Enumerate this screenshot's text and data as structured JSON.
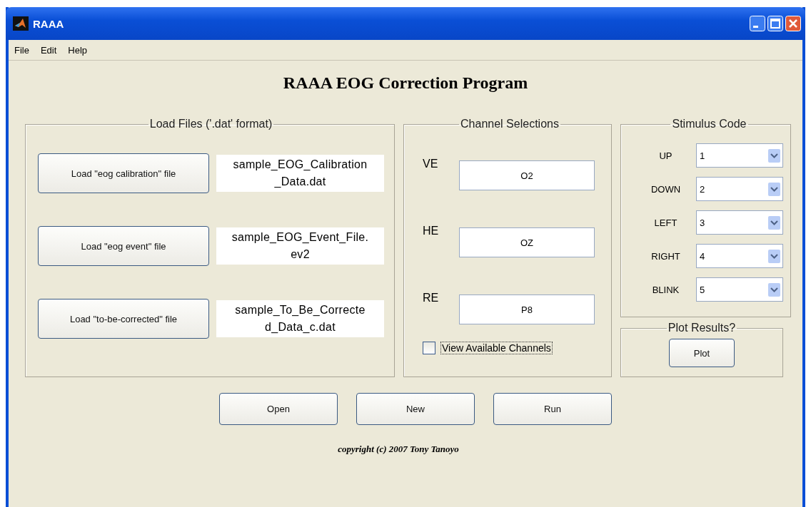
{
  "window": {
    "title": "RAAA"
  },
  "menu": [
    "File",
    "Edit",
    "Help"
  ],
  "heading": "RAAA EOG Correction Program",
  "load_files": {
    "title": "Load Files ('.dat' format)",
    "rows": [
      {
        "button": "Load \"eog calibration\" file",
        "file_lines": [
          "sample_EOG_Calibration",
          "_Data.dat"
        ]
      },
      {
        "button": "Load \"eog event\" file",
        "file_lines": [
          "sample_EOG_Event_File.",
          "ev2"
        ]
      },
      {
        "button": "Load \"to-be-corrected\" file",
        "file_lines": [
          "sample_To_Be_Correcte",
          "d_Data_c.dat"
        ]
      }
    ]
  },
  "channel_selections": {
    "title": "Channel Selections",
    "channels": [
      {
        "label": "VE",
        "value": "O2"
      },
      {
        "label": "HE",
        "value": "OZ"
      },
      {
        "label": "RE",
        "value": "P8"
      }
    ],
    "view_available": {
      "label": "View Available Channels",
      "checked": false
    }
  },
  "stimulus_code": {
    "title": "Stimulus Code",
    "codes": [
      {
        "label": "UP",
        "value": "1"
      },
      {
        "label": "DOWN",
        "value": "2"
      },
      {
        "label": "LEFT",
        "value": "3"
      },
      {
        "label": "RIGHT",
        "value": "4"
      },
      {
        "label": "BLINK",
        "value": "5"
      }
    ]
  },
  "plot_results": {
    "title": "Plot Results?",
    "button": "Plot"
  },
  "buttons": [
    "Open",
    "New",
    "Run"
  ],
  "copyright": "copyright (c) 2007 Tony Tanoyo"
}
